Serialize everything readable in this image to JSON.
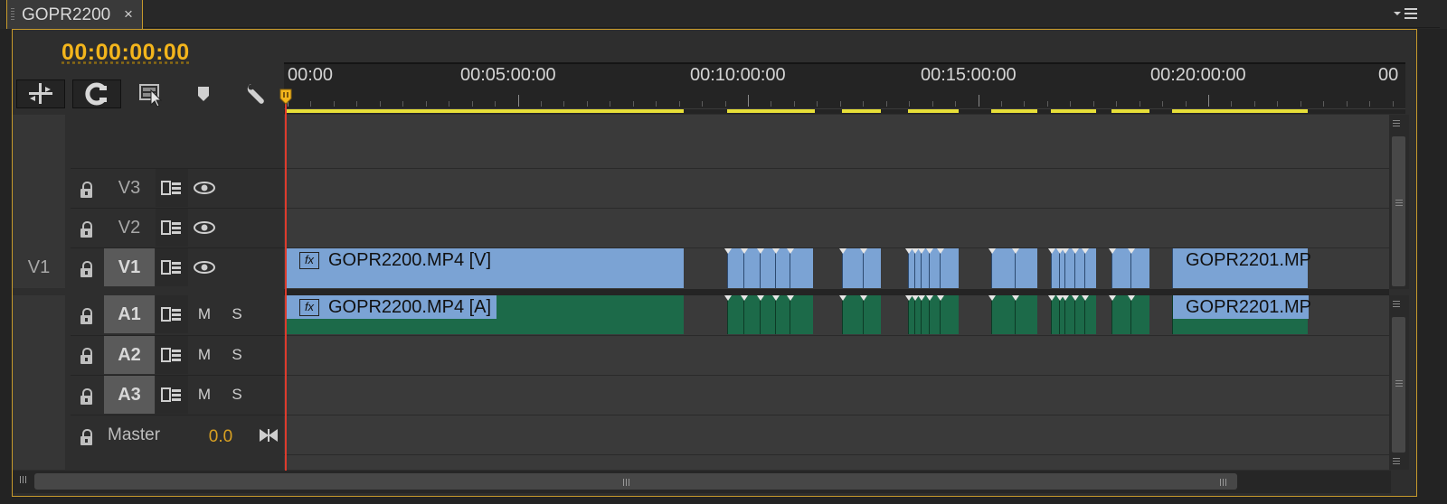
{
  "tab": {
    "title": "GOPR2200",
    "close_glyph": "×"
  },
  "panel_menu_icon": "panel-menu-icon",
  "timecode": "00:00:00:00",
  "tools": [
    {
      "name": "insert-edit-icon"
    },
    {
      "name": "snap-icon"
    },
    {
      "name": "linked-selection-icon"
    },
    {
      "name": "add-marker-icon"
    },
    {
      "name": "timeline-settings-wrench-icon"
    }
  ],
  "ruler": {
    "labels": [
      "00:00",
      "00:05:00:00",
      "00:10:00:00",
      "00:15:00:00",
      "00:20:00:00",
      "00"
    ]
  },
  "tracks": {
    "video": [
      {
        "name": "V3",
        "target": false,
        "source": ""
      },
      {
        "name": "V2",
        "target": false,
        "source": ""
      },
      {
        "name": "V1",
        "target": true,
        "source": "V1"
      }
    ],
    "audio": [
      {
        "name": "A1",
        "mute": "M",
        "solo": "S"
      },
      {
        "name": "A2",
        "mute": "M",
        "solo": "S"
      },
      {
        "name": "A3",
        "mute": "M",
        "solo": "S"
      }
    ],
    "master": {
      "label": "Master",
      "value": "0.0"
    }
  },
  "clips": {
    "v1_first": "GOPR2200.MP4 [V]",
    "a1_first": "GOPR2200.MP4 [A]",
    "v1_last": "GOPR2201.MP",
    "a1_last": "GOPR2201.MP",
    "fx_badge": "fx"
  },
  "colors": {
    "accent": "#c79a2c",
    "timecode": "#f3b51c",
    "video_clip": "#7ba3d4",
    "audio_clip": "#1c6a49",
    "playhead": "#dd3b2c",
    "work_area": "#e7df38",
    "master_value": "#d8a022"
  }
}
